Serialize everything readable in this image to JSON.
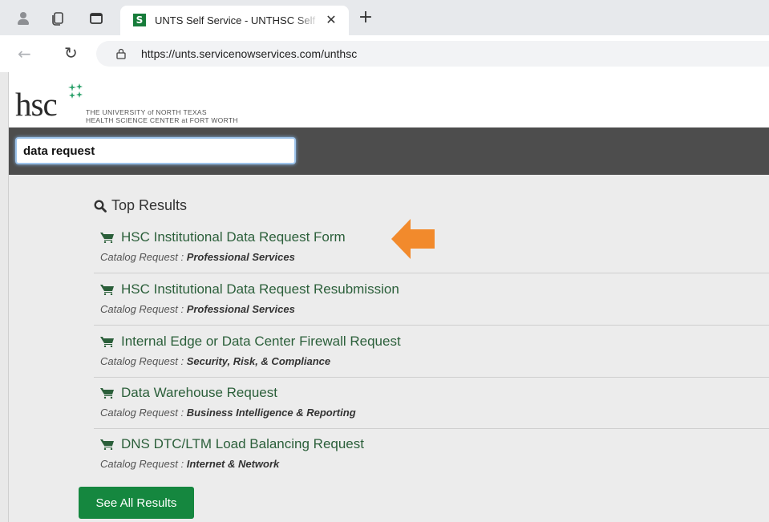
{
  "browser": {
    "tab_title": "UNTS Self Service - UNTHSC Self Service",
    "favicon_text": "S",
    "close_tab": "✕",
    "new_tab": "+",
    "url": "https://unts.servicenowservices.com/unthsc"
  },
  "brand": {
    "logo": "hsc",
    "line1": "THE UNIVERSITY of NORTH TEXAS",
    "line2": "HEALTH SCIENCE CENTER at FORT WORTH"
  },
  "search": {
    "value": "data request"
  },
  "results": {
    "heading": "Top Results",
    "category_prefix": "Catalog Request :",
    "items": [
      {
        "title": "HSC Institutional Data Request Form",
        "category": "Professional Services"
      },
      {
        "title": "HSC Institutional Data Request Resubmission",
        "category": "Professional Services"
      },
      {
        "title": "Internal Edge or Data Center Firewall Request",
        "category": "Security, Risk, & Compliance"
      },
      {
        "title": "Data Warehouse Request",
        "category": "Business Intelligence & Reporting"
      },
      {
        "title": "DNS DTC/LTM Load Balancing Request",
        "category": "Internet & Network"
      }
    ],
    "see_all_label": "See All Results"
  },
  "colors": {
    "result_link": "#2b5f3a",
    "button_green": "#15873f",
    "annotation_arrow": "#f28a2c",
    "search_band": "#4d4d4d"
  }
}
